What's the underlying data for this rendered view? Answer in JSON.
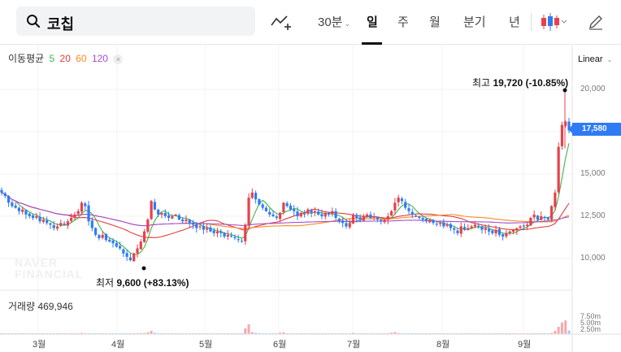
{
  "search": {
    "query": "코칩"
  },
  "toolbar": {
    "interval_label": "30분",
    "periods": [
      "일",
      "주",
      "월",
      "분기",
      "년"
    ],
    "active_period": "일",
    "scale": "Linear"
  },
  "colors": {
    "up": "#e8414b",
    "down": "#2f7bf5",
    "ma5": "#3fb64a",
    "ma20": "#e33d3d",
    "ma60": "#ff8a1e",
    "ma120": "#a24dd1",
    "badge": "#2f7bf5"
  },
  "legend": {
    "title": "이동평균",
    "items": [
      {
        "label": "5",
        "color": "#3fb64a"
      },
      {
        "label": "20",
        "color": "#e33d3d"
      },
      {
        "label": "60",
        "color": "#ff8a1e"
      },
      {
        "label": "120",
        "color": "#a24dd1"
      }
    ]
  },
  "annotations": {
    "high_prefix": "최고",
    "high_value": "19,720 (-10.85%)",
    "low_prefix": "최저",
    "low_value": "9,600 (+83.13%)",
    "current_price": "17,580"
  },
  "volume": {
    "label": "거래량 469,946",
    "ticks": [
      "7.50m",
      "5.00m",
      "2.50m"
    ]
  },
  "watermark": [
    "NAVER",
    "FINANCIAL"
  ],
  "chart_data": {
    "type": "candlestick",
    "title": "",
    "y_ticks": [
      "20,000",
      "17,500",
      "15,000",
      "12,500",
      "10,000"
    ],
    "ylim": [
      9500,
      21000
    ],
    "x_ticks": [
      "3월",
      "4월",
      "5월",
      "6월",
      "7월",
      "8월",
      "9월"
    ],
    "close": [
      13900,
      13700,
      13300,
      13100,
      13000,
      12800,
      12900,
      12600,
      12500,
      12400,
      12500,
      12200,
      12300,
      12100,
      12000,
      11800,
      11900,
      12100,
      12000,
      12200,
      12400,
      12600,
      12800,
      13300,
      13100,
      12200,
      11800,
      11400,
      11200,
      11400,
      11100,
      11000,
      10900,
      10700,
      10600,
      10300,
      10100,
      9900,
      10300,
      10600,
      11000,
      11600,
      12300,
      13400,
      12900,
      12600,
      12700,
      12500,
      12400,
      12500,
      12600,
      12300,
      12200,
      12300,
      12100,
      12000,
      11800,
      11900,
      11700,
      11800,
      11600,
      11500,
      11600,
      11500,
      11300,
      11400,
      11300,
      11200,
      11100,
      11000,
      12000,
      13600,
      13900,
      13500,
      13200,
      13000,
      12800,
      12600,
      12500,
      12400,
      12700,
      13300,
      13100,
      12900,
      12800,
      12500,
      12700,
      12600,
      12900,
      12700,
      12800,
      12600,
      12500,
      12700,
      12600,
      12800,
      12400,
      12200,
      12100,
      11900,
      12100,
      12600,
      12400,
      12300,
      12500,
      12600,
      12400,
      12500,
      12300,
      12200,
      12300,
      12500,
      12800,
      13300,
      13600,
      13400,
      13000,
      12800,
      12600,
      12500,
      12400,
      12300,
      12200,
      12300,
      12100,
      12000,
      12100,
      11900,
      12000,
      11800,
      11700,
      11500,
      11900,
      11700,
      11800,
      11900,
      12000,
      11900,
      11700,
      11800,
      11600,
      11500,
      11700,
      11400,
      11300,
      11500,
      11600,
      11700,
      11800,
      11900,
      11900,
      12000,
      12400,
      12600,
      12300,
      12500,
      12400,
      12300,
      13100,
      13900,
      16600,
      17900,
      18100,
      17580
    ],
    "volume_m": [
      0.4,
      0.3,
      0.3,
      0.2,
      0.2,
      0.2,
      0.2,
      0.2,
      0.3,
      0.2,
      0.2,
      0.2,
      0.2,
      0.2,
      0.2,
      0.2,
      0.2,
      0.2,
      0.2,
      0.2,
      0.3,
      0.3,
      0.3,
      0.5,
      0.4,
      0.4,
      0.3,
      0.3,
      0.3,
      0.2,
      0.2,
      0.2,
      0.2,
      0.2,
      0.2,
      0.3,
      0.3,
      0.4,
      0.3,
      0.3,
      0.4,
      0.5,
      0.8,
      1.4,
      0.6,
      0.4,
      0.3,
      0.3,
      0.3,
      0.2,
      0.2,
      0.2,
      0.2,
      0.2,
      0.2,
      0.2,
      0.2,
      0.2,
      0.2,
      0.2,
      0.2,
      0.2,
      0.2,
      0.2,
      0.2,
      0.2,
      0.2,
      0.2,
      0.3,
      0.4,
      2.5,
      4.3,
      0.9,
      0.6,
      0.4,
      0.3,
      0.3,
      0.3,
      0.3,
      0.3,
      0.6,
      0.8,
      0.4,
      0.3,
      0.3,
      0.3,
      0.3,
      0.3,
      0.3,
      0.3,
      0.3,
      0.3,
      0.3,
      0.3,
      0.2,
      0.3,
      0.2,
      0.2,
      0.2,
      0.2,
      0.3,
      0.5,
      0.3,
      0.3,
      0.3,
      0.3,
      0.3,
      0.3,
      0.2,
      0.2,
      0.3,
      0.4,
      0.6,
      0.9,
      0.5,
      0.4,
      0.3,
      0.3,
      0.3,
      0.2,
      0.2,
      0.2,
      0.2,
      0.2,
      0.2,
      0.2,
      0.2,
      0.2,
      0.2,
      0.2,
      0.2,
      0.2,
      0.3,
      0.2,
      0.2,
      0.2,
      0.2,
      0.2,
      0.2,
      0.2,
      0.2,
      0.2,
      0.2,
      0.2,
      0.2,
      0.2,
      0.2,
      0.2,
      0.2,
      0.2,
      0.2,
      0.3,
      0.3,
      0.4,
      0.3,
      0.3,
      0.3,
      0.3,
      0.5,
      1.4,
      3.2,
      5.1,
      6.0,
      1.6
    ]
  }
}
